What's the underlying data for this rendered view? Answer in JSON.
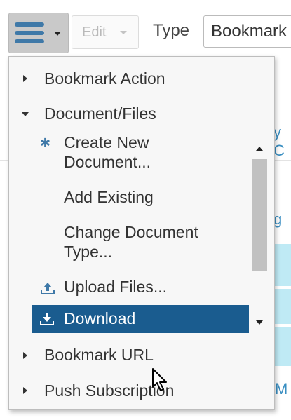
{
  "toolbar": {
    "edit_label": "Edit",
    "type_label": "Type",
    "type_value": "Bookmark"
  },
  "background": {
    "frag_1": "y C",
    "frag_2": "g",
    "frag_3": "M"
  },
  "menu": {
    "items": [
      {
        "label": "Bookmark Action",
        "expanded": false
      },
      {
        "label": "Document/Files",
        "expanded": true
      },
      {
        "label": "Bookmark URL",
        "expanded": false
      },
      {
        "label": "Push Subscription",
        "expanded": false
      }
    ],
    "submenu": {
      "create_line1": "Create New",
      "create_line2": "Document...",
      "add_existing": "Add Existing",
      "change_line1": "Change Document",
      "change_line2": "Type...",
      "upload": "Upload Files...",
      "download": "Download"
    }
  },
  "colors": {
    "accent": "#3f79a8",
    "highlight": "#1a5c8f",
    "row_highlight": "#bfeaf5"
  },
  "icons": {
    "create": "asterisk-icon",
    "upload": "upload-icon",
    "download": "download-icon"
  }
}
